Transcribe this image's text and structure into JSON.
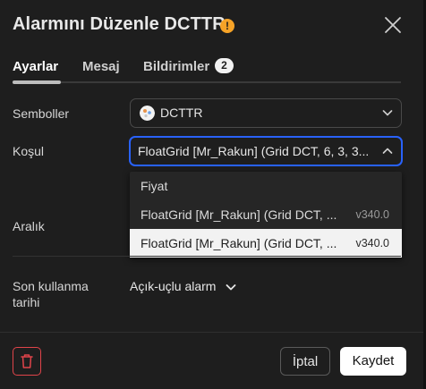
{
  "header": {
    "title": "Alarmını Düzenle DCTTR",
    "warning_icon": "!"
  },
  "tabs": [
    {
      "label": "Ayarlar"
    },
    {
      "label": "Mesaj"
    },
    {
      "label": "Bildirimler",
      "badge": "2"
    }
  ],
  "form": {
    "symbols_label": "Semboller",
    "symbol_value": "DCTTR",
    "condition_label": "Koşul",
    "condition_value": "FloatGrid [Mr_Rakun] (Grid DCT, 6, 3, 3...",
    "interval_label": "Aralık",
    "expiry_label_line1": "Son kullanma",
    "expiry_label_line2": "tarihi",
    "expiry_value": "Açık-uçlu alarm"
  },
  "dropdown": {
    "options": [
      {
        "text": "Fiyat",
        "version": ""
      },
      {
        "text": "FloatGrid [Mr_Rakun] (Grid DCT, ...",
        "version": "v340.0"
      },
      {
        "text": "FloatGrid [Mr_Rakun] (Grid DCT, ...",
        "version": "v340.0"
      }
    ]
  },
  "footer": {
    "cancel_label": "İptal",
    "save_label": "Kaydet"
  },
  "colors": {
    "accent_focus": "#2962ff",
    "warning": "#f6a327",
    "delete": "#e0444a"
  }
}
